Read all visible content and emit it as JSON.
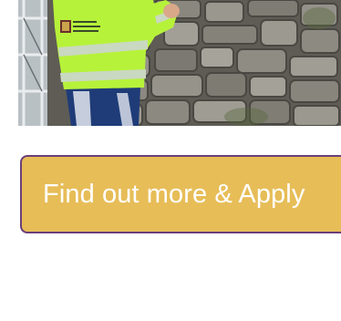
{
  "hero": {
    "image_alt": "Worker in hi-vis jacket repairing a stone wall",
    "jacket_logo_text": "Clare Conservation & Restoration"
  },
  "cta": {
    "label": "Find out more & Apply",
    "background_color": "#e7bd58",
    "border_color": "#6b3f78",
    "text_color": "#ffffff"
  }
}
